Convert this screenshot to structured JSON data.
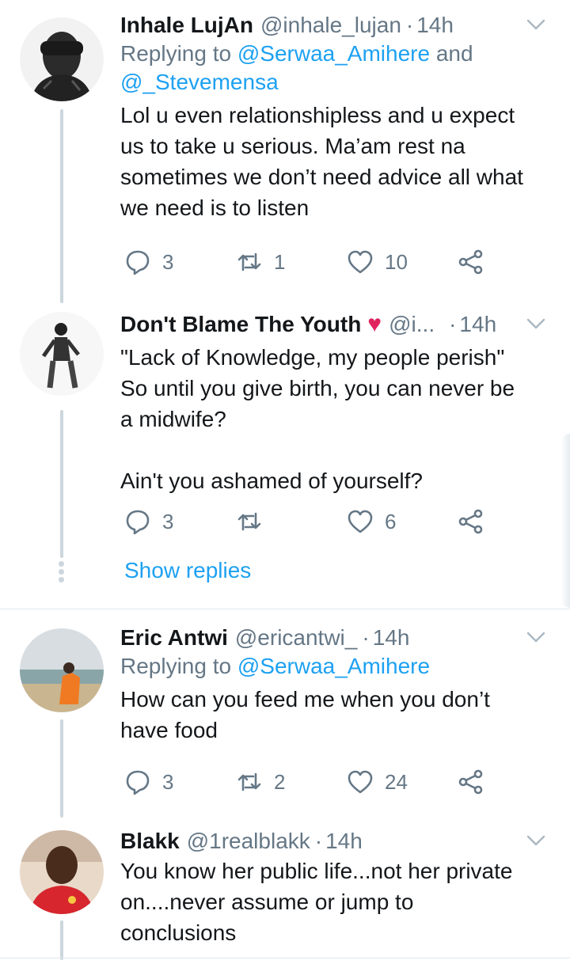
{
  "tweets": [
    {
      "name": "Inhale LujAn",
      "handle": "@inhale_lujan",
      "dot": "·",
      "time": "14h",
      "replying_prefix": "Replying to ",
      "replying_1": "@Serwaa_Amihere",
      "replying_and": " and",
      "replying_2": "@_Stevemensa",
      "text": "Lol u even relationshipless and u expect\nus to take u serious. Ma’am rest na\nsometimes we don’t need advice all what\nwe need is to listen",
      "replies": "3",
      "retweets": "1",
      "likes": "10"
    },
    {
      "name": "Don't Blame The Youth",
      "handle": "@i...",
      "dot": "·",
      "time": "14h",
      "text": "\"Lack of Knowledge, my people perish\"\nSo until you give birth, you can never be\na midwife?\n\nAin't you ashamed of yourself?",
      "replies": "3",
      "retweets": "",
      "likes": "6"
    },
    {
      "name": "Eric Antwi",
      "handle": "@ericantwi_",
      "dot": "·",
      "time": "14h",
      "replying_prefix": "Replying to ",
      "replying_1": "@Serwaa_Amihere",
      "text": "How can you feed me when you don’t\nhave food",
      "replies": "3",
      "retweets": "2",
      "likes": "24"
    },
    {
      "name": "Blakk",
      "handle": "@1realblakk",
      "dot": "·",
      "time": "14h",
      "text": "You know her public life...not her private\non....never assume or jump to\nconclusions"
    }
  ],
  "show_replies": "Show replies",
  "colors": {
    "link": "#1da1f2",
    "muted": "#657786",
    "heart": "#e0245e",
    "line": "#ccd6dd"
  },
  "icons": [
    "reply-icon",
    "retweet-icon",
    "like-icon",
    "share-icon",
    "chevron-down-icon",
    "heart-emoji"
  ]
}
